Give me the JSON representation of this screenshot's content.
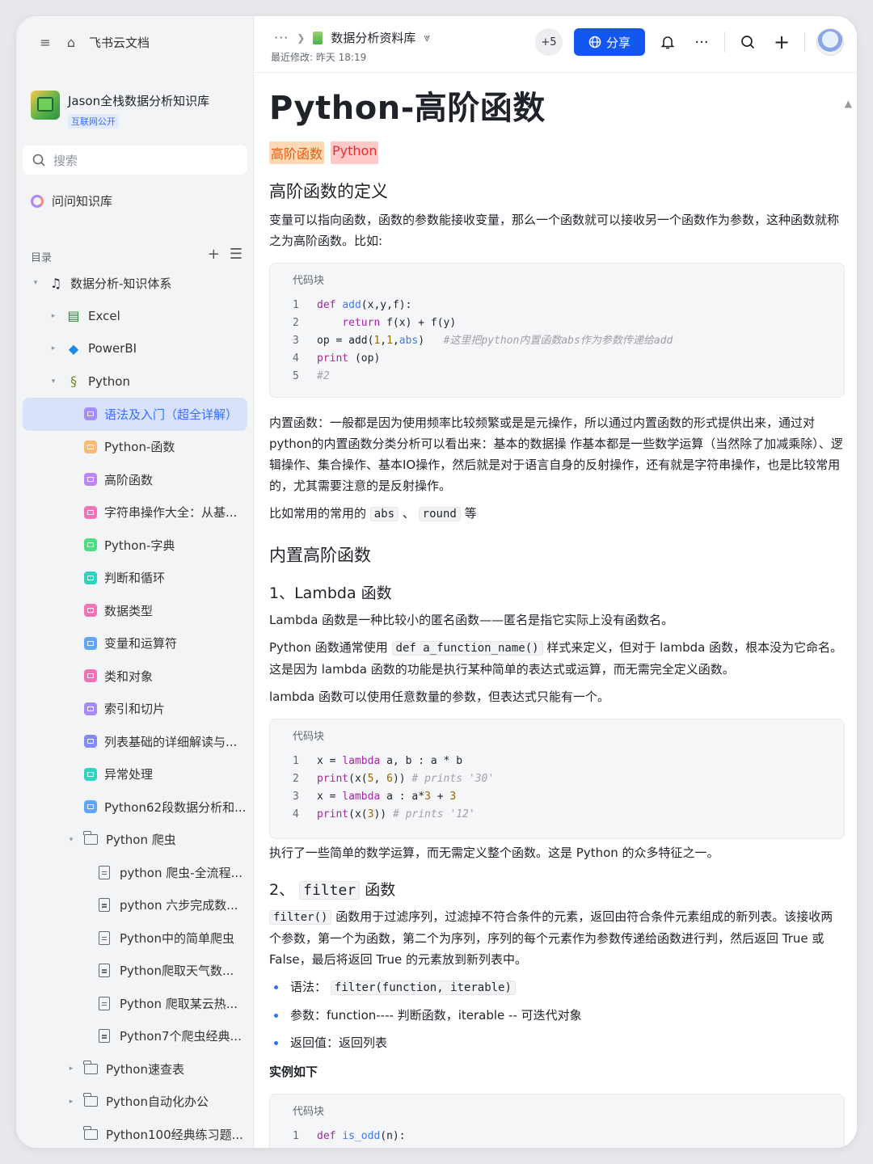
{
  "app": {
    "name": "飞书云文档"
  },
  "knowledge_base": {
    "title": "Jason全栈数据分析知识库",
    "badge": "互联网公开"
  },
  "sidebar": {
    "search_placeholder": "搜索",
    "ask": "问问知识库",
    "toc_label": "目录",
    "tree": [
      {
        "label": "数据分析-知识体系",
        "level": 0,
        "arrow": "▾",
        "icon": "music-icon",
        "color": "#1f2329"
      },
      {
        "label": "Excel",
        "level": 1,
        "arrow": "▸",
        "icon": "excel-icon",
        "color": "#2e7d32"
      },
      {
        "label": "PowerBI",
        "level": 1,
        "arrow": "▸",
        "icon": "diamond-icon",
        "color": "#1e88e5"
      },
      {
        "label": "Python",
        "level": 1,
        "arrow": "▾",
        "icon": "snake-icon",
        "color": "#6d8f1f"
      },
      {
        "label": "语法及入门（超全详解）",
        "level": 2,
        "icon": "doc-square-icon",
        "color": "#a78bfa",
        "active": true
      },
      {
        "label": "Python-函数",
        "level": 2,
        "icon": "doc-square-icon",
        "color": "#fdba74"
      },
      {
        "label": "高阶函数",
        "level": 2,
        "icon": "doc-square-icon",
        "color": "#c084fc"
      },
      {
        "label": "字符串操作大全：从基...",
        "level": 2,
        "icon": "doc-square-icon",
        "color": "#f472b6"
      },
      {
        "label": "Python-字典",
        "level": 2,
        "icon": "doc-square-icon",
        "color": "#4ade80"
      },
      {
        "label": "判断和循环",
        "level": 2,
        "icon": "doc-square-icon",
        "color": "#2dd4bf"
      },
      {
        "label": "数据类型",
        "level": 2,
        "icon": "doc-square-icon",
        "color": "#f472b6"
      },
      {
        "label": "变量和运算符",
        "level": 2,
        "icon": "doc-square-icon",
        "color": "#60a5fa"
      },
      {
        "label": "类和对象",
        "level": 2,
        "icon": "doc-square-icon",
        "color": "#f472b6"
      },
      {
        "label": "索引和切片",
        "level": 2,
        "icon": "doc-square-icon",
        "color": "#a78bfa"
      },
      {
        "label": "列表基础的详细解读与...",
        "level": 2,
        "icon": "doc-square-icon",
        "color": "#818cf8"
      },
      {
        "label": "异常处理",
        "level": 2,
        "icon": "doc-square-icon",
        "color": "#2dd4bf"
      },
      {
        "label": "Python62段数据分析和...",
        "level": 2,
        "icon": "doc-square-icon",
        "color": "#60a5fa"
      },
      {
        "label": "Python 爬虫",
        "level": 2,
        "arrow": "▾",
        "icon": "folder-icon",
        "folder": true
      },
      {
        "label": "python 爬虫-全流程...",
        "level": 3,
        "icon": "doc-icon",
        "doc": true
      },
      {
        "label": "python 六步完成数...",
        "level": 3,
        "icon": "doc-icon",
        "doc": true
      },
      {
        "label": "Python中的简单爬虫",
        "level": 3,
        "icon": "doc-icon",
        "doc": true
      },
      {
        "label": "Python爬取天气数...",
        "level": 3,
        "icon": "doc-icon",
        "doc": true
      },
      {
        "label": "Python 爬取某云热...",
        "level": 3,
        "icon": "doc-icon",
        "doc": true
      },
      {
        "label": "Python7个爬虫经典...",
        "level": 3,
        "icon": "doc-icon",
        "doc": true
      },
      {
        "label": "Python速查表",
        "level": 2,
        "arrow": "▸",
        "icon": "folder-icon",
        "folder": true
      },
      {
        "label": "Python自动化办公",
        "level": 2,
        "arrow": "▸",
        "icon": "folder-icon",
        "folder": true
      },
      {
        "label": "Python100经典练习题...",
        "level": 2,
        "icon": "folder-icon",
        "folder": true
      }
    ]
  },
  "header": {
    "crumb_dots": "···",
    "crumb_title": "数据分析资料库",
    "modified": "最近修改: 昨天 18:19",
    "collaborators": "+5",
    "share": "分享"
  },
  "doc": {
    "title": "Python-高阶函数",
    "tags": [
      {
        "text": "高阶函数",
        "bg": "#ffd9b3",
        "color": "#e8590c"
      },
      {
        "text": "Python",
        "bg": "#ffc9c9",
        "color": "#e03131"
      }
    ],
    "h_def": "高阶函数的定义",
    "p_def": "变量可以指向函数，函数的参数能接收变量，那么一个函数就可以接收另一个函数作为参数，这种函数就称之为高阶函数。比如:",
    "code_label": "代码块",
    "p_builtin": "内置函数：一般都是因为使用频率比较频繁或是是元操作，所以通过内置函数的形式提供出来，通过对python的内置函数分类分析可以看出来：基本的数据操 作基本都是一些数学运算（当然除了加减乘除）、逻辑操作、集合操作、基本IO操作，然后就是对于语言自身的反射操作，还有就是字符串操作，也是比较常用 的，尤其需要注意的是反射操作。",
    "p_common_pre": "比如常用的常用的",
    "p_common_abs": "abs",
    "p_common_sep": "、",
    "p_common_round": "round",
    "p_common_post": "等",
    "h_builtin_hof": "内置高阶函数",
    "h_lambda": "1、Lambda 函数",
    "p_lambda1": "Lambda 函数是一种比较小的匿名函数——匿名是指它实际上没有函数名。",
    "p_lambda2_pre": "Python 函数通常使用",
    "p_lambda2_code": "def a_function_name()",
    "p_lambda2_post": "样式来定义，但对于 lambda 函数，根本没为它命名。这是因为 lambda 函数的功能是执行某种简单的表达式或运算，而无需完全定义函数。",
    "p_lambda3": "lambda 函数可以使用任意数量的参数，但表达式只能有一个。",
    "p_after_lambda": "执行了一些简单的数学运算，而无需定义整个函数。这是 Python 的众多特征之一。",
    "h_filter_pre": "2、",
    "h_filter_code": "filter",
    "h_filter_post": "函数",
    "p_filter_code": "filter()",
    "p_filter": "函数用于过滤序列，过滤掉不符合条件的元素，返回由符合条件元素组成的新列表。该接收两个参数，第一个为函数，第二个为序列，序列的每个元素作为参数传递给函数进行判，然后返回 True 或 False，最后将返回 True 的元素放到新列表中。",
    "b1_label": "语法：",
    "b1_code": "filter(function, iterable)",
    "b2": "参数：function---- 判断函数，iterable -- 可迭代对象",
    "b3": "返回值：返回列表",
    "example": "实例如下"
  },
  "code1": [
    {
      "n": "1"
    },
    {
      "n": "2"
    },
    {
      "n": "3",
      "comment": "#这里把python内置函数abs作为参数传递给add"
    },
    {
      "n": "4"
    },
    {
      "n": "5",
      "comment": "#2"
    }
  ],
  "code2": [
    {
      "n": "1",
      "comment": ""
    },
    {
      "n": "2",
      "comment": "# prints '30'"
    },
    {
      "n": "3"
    },
    {
      "n": "4",
      "comment": "# prints '12'"
    }
  ],
  "code3": [
    {
      "n": "1"
    }
  ]
}
